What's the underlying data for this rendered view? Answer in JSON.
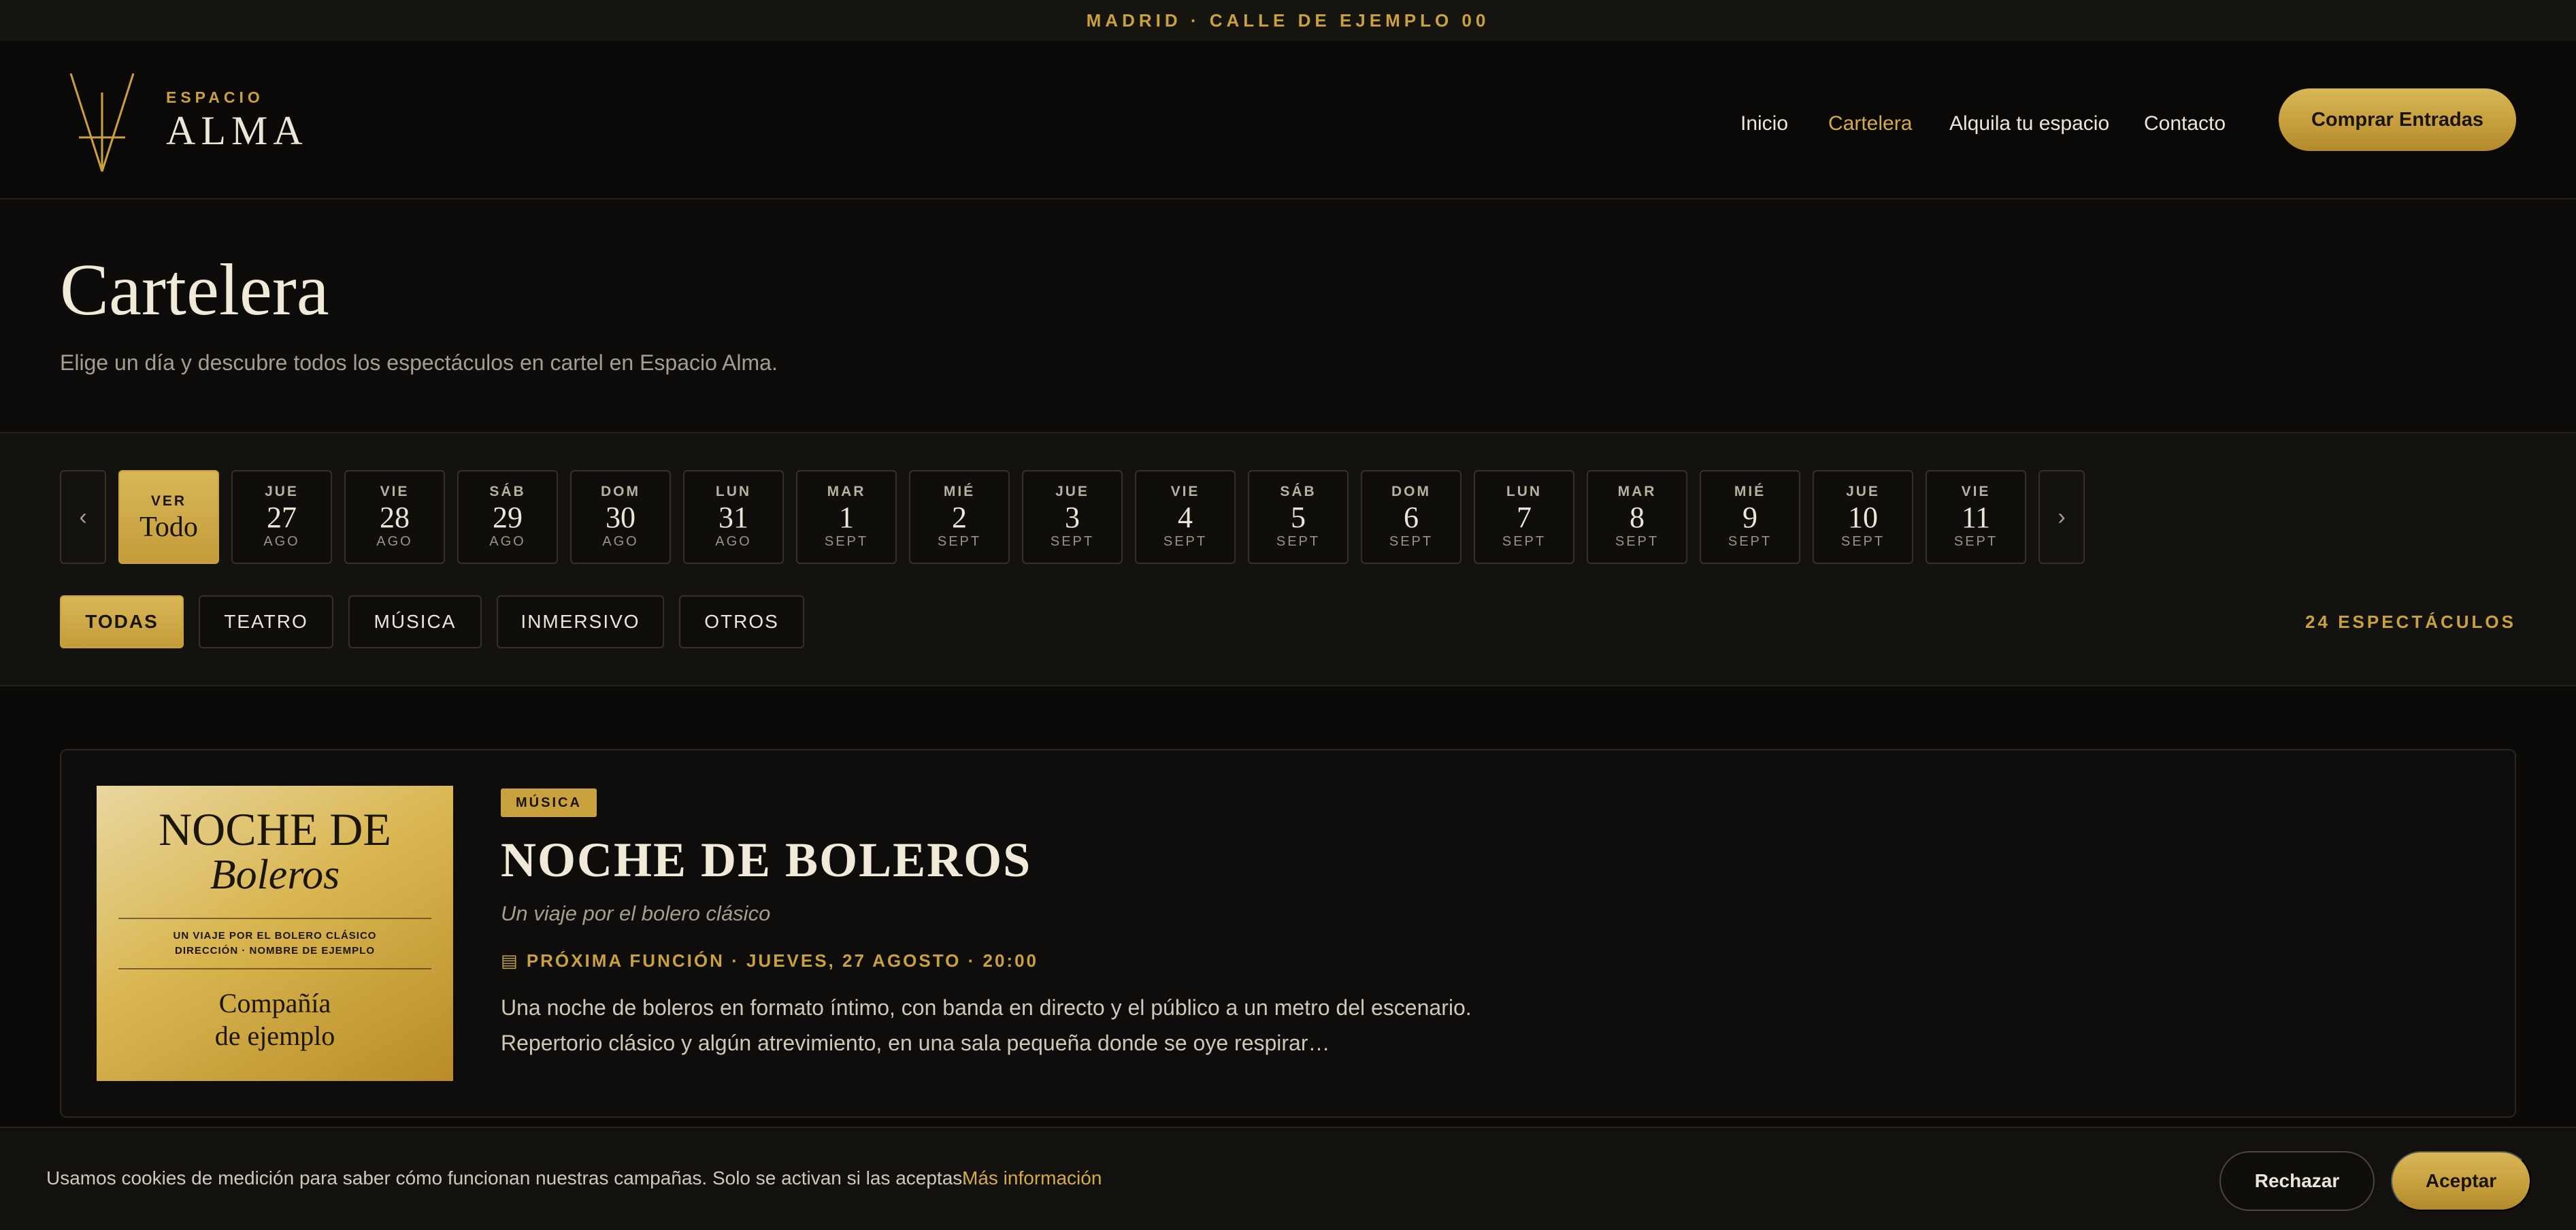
{
  "topbar": {
    "text": "MADRID · CALLE DE EJEMPLO 00"
  },
  "brand": {
    "kicker": "ESPACIO",
    "name": "ALMA",
    "accent": "#c9a23d"
  },
  "nav": {
    "items": [
      "Inicio",
      "Cartelera",
      "Alquila tu espacio",
      "Contacto"
    ],
    "active": "Cartelera",
    "cta": "Comprar Entradas"
  },
  "hero": {
    "title": "Cartelera",
    "subtitle": "Elige un día y descubre todos los espectáculos en cartel en Espacio Alma."
  },
  "dates": {
    "prev_icon": "chevron-left-icon",
    "next_icon": "chevron-right-icon",
    "prev_glyph": "‹",
    "next_glyph": "›",
    "all": {
      "top": "VER",
      "main": "Todo"
    },
    "days": [
      {
        "wd": "JUE",
        "num": "27",
        "mon": "AGO"
      },
      {
        "wd": "VIE",
        "num": "28",
        "mon": "AGO"
      },
      {
        "wd": "SÁB",
        "num": "29",
        "mon": "AGO"
      },
      {
        "wd": "DOM",
        "num": "30",
        "mon": "AGO"
      },
      {
        "wd": "LUN",
        "num": "31",
        "mon": "AGO"
      },
      {
        "wd": "MAR",
        "num": "1",
        "mon": "SEPT"
      },
      {
        "wd": "MIÉ",
        "num": "2",
        "mon": "SEPT"
      },
      {
        "wd": "JUE",
        "num": "3",
        "mon": "SEPT"
      },
      {
        "wd": "VIE",
        "num": "4",
        "mon": "SEPT"
      },
      {
        "wd": "SÁB",
        "num": "5",
        "mon": "SEPT"
      },
      {
        "wd": "DOM",
        "num": "6",
        "mon": "SEPT"
      },
      {
        "wd": "LUN",
        "num": "7",
        "mon": "SEPT"
      },
      {
        "wd": "MAR",
        "num": "8",
        "mon": "SEPT"
      },
      {
        "wd": "MIÉ",
        "num": "9",
        "mon": "SEPT"
      },
      {
        "wd": "JUE",
        "num": "10",
        "mon": "SEPT"
      },
      {
        "wd": "VIE",
        "num": "11",
        "mon": "SEPT"
      }
    ]
  },
  "categories": {
    "items": [
      "TODAS",
      "TEATRO",
      "MÚSICA",
      "INMERSIVO",
      "OTROS"
    ],
    "active": "TODAS",
    "count": "24 ESPECTÁCULOS"
  },
  "show": {
    "badge": "MÚSICA",
    "title": "NOCHE DE BOLEROS",
    "subtitle": "Un viaje por el bolero clásico",
    "next_icon": "calendar-icon",
    "next_glyph": "▤",
    "next": "PRÓXIMA FUNCIÓN · JUEVES, 27 AGOSTO · 20:00",
    "description": "Una noche de boleros en formato íntimo, con banda en directo y el público a un metro del escenario. Repertorio clásico y algún atrevimiento, en una sala pequeña donde se oye respirar…",
    "poster": {
      "line1": "NOCHE DE",
      "line2": "Boleros",
      "small1": "UN VIAJE POR EL BOLERO CLÁSICO",
      "small2": "DIRECCIÓN · NOMBRE DE EJEMPLO",
      "company1": "Compañía",
      "company2": "de ejemplo"
    }
  },
  "cookie": {
    "text": "Usamos cookies de medición para saber cómo funcionan nuestras campañas. Solo se activan si las aceptas.",
    "link": "Más información",
    "reject": "Rechazar",
    "accept": "Aceptar"
  }
}
